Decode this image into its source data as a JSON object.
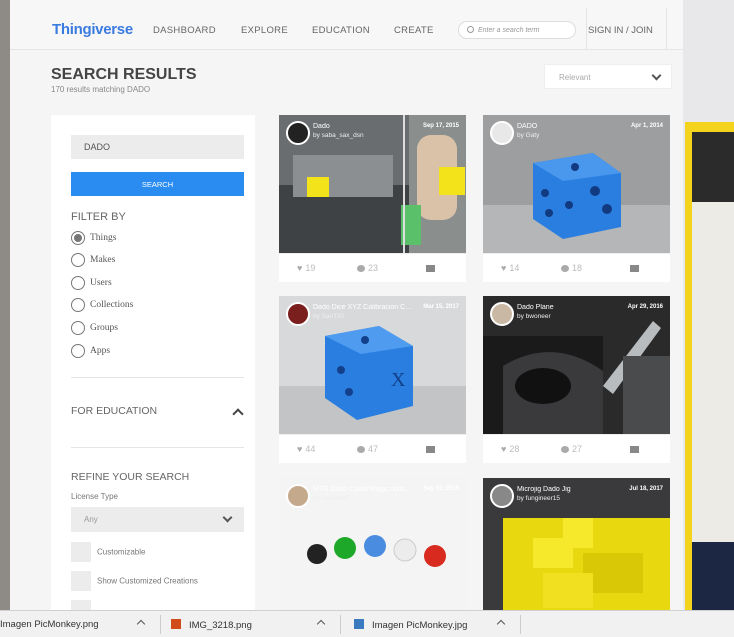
{
  "header": {
    "logo": "Thingiverse",
    "nav": [
      "DASHBOARD",
      "EXPLORE",
      "EDUCATION",
      "CREATE"
    ],
    "search_placeholder": "Enter a search term",
    "signin": "SIGN IN / JOIN"
  },
  "results": {
    "title": "SEARCH RESULTS",
    "subtitle": "170 results matching DADO",
    "sort": "Relevant"
  },
  "sidebar": {
    "term": "DADO",
    "search_button": "SEARCH",
    "filter_heading": "FILTER BY",
    "filters": [
      {
        "label": "Things",
        "selected": true
      },
      {
        "label": "Makes",
        "selected": false
      },
      {
        "label": "Users",
        "selected": false
      },
      {
        "label": "Collections",
        "selected": false
      },
      {
        "label": "Groups",
        "selected": false
      },
      {
        "label": "Apps",
        "selected": false
      }
    ],
    "education_heading": "FOR EDUCATION",
    "refine_heading": "REFINE YOUR SEARCH",
    "license_label": "License Type",
    "license_value": "Any",
    "checkboxes": [
      "Customizable",
      "Show Customized Creations"
    ]
  },
  "cards": [
    {
      "title": "Dado",
      "by": "by saba_sax_dsn",
      "date": "Sep 17, 2015",
      "likes": "19",
      "comments": "23"
    },
    {
      "title": "DADO",
      "by": "by Gaty",
      "date": "Apr 1, 2014",
      "likes": "14",
      "comments": "18"
    },
    {
      "title": "Dado Dice XYZ Calibracion C...",
      "by": "by SanT82",
      "date": "Mar 15, 2017",
      "likes": "44",
      "comments": "47"
    },
    {
      "title": "Dado Plane",
      "by": "by bwoneer",
      "date": "Apr 29, 2016",
      "likes": "28",
      "comments": "27"
    },
    {
      "title": "MTG Dado Carbs Magic cont...",
      "by": "by monoly60",
      "date": "Sep 10, 2015",
      "likes": "",
      "comments": ""
    },
    {
      "title": "Microjig Dado Jig",
      "by": "by fungineer15",
      "date": "Jul 18, 2017",
      "likes": "",
      "comments": ""
    }
  ],
  "downloads": [
    {
      "name": "Imagen PicMonkey.png"
    },
    {
      "name": "IMG_3218.png"
    },
    {
      "name": "Imagen PicMonkey.jpg"
    }
  ],
  "colors": {
    "accent": "#2a8cf0",
    "logo": "#3a7be0",
    "die_blue": "#2a7ee0",
    "die_yellow": "#f3e31a"
  }
}
